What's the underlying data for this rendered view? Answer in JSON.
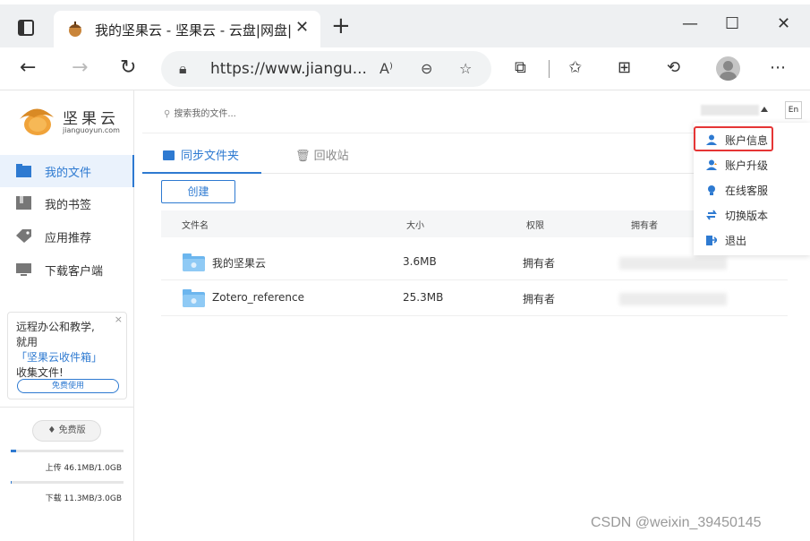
{
  "browser": {
    "tab_title": "我的坚果云 - 坚果云 - 云盘|网盘|",
    "tab_close": "✕",
    "new_tab": "+",
    "url": "https://www.jiangu...",
    "minimize": "—",
    "maximize": "☐",
    "close": "✕",
    "icons": [
      "sidebar-icon",
      "back-icon",
      "forward-icon",
      "refresh-icon",
      "lock-icon",
      "read-aloud-icon",
      "zoom-icon",
      "favorite-add-icon",
      "extensions-icon",
      "favorites-icon",
      "collections-icon",
      "history-icon",
      "profile-icon",
      "more-icon"
    ]
  },
  "app": {
    "logo_text": "坚果云",
    "logo_sub": "jianguoyun.com",
    "sidebar": {
      "items": [
        {
          "label": "我的文件",
          "icon": "folder-icon",
          "active": true
        },
        {
          "label": "我的书签",
          "icon": "bookmark-icon",
          "active": false
        },
        {
          "label": "应用推荐",
          "icon": "tag-icon",
          "active": false
        },
        {
          "label": "下载客户端",
          "icon": "monitor-icon",
          "active": false
        }
      ]
    },
    "promo": {
      "line1": "远程办公和教学,",
      "line2_prefix": "就用",
      "line2_link": "「坚果云收件箱」",
      "line3": "收集文件!",
      "button": "免费使用",
      "close": "×"
    },
    "plan": "免费版",
    "upload": {
      "text": "上传 46.1MB/1.0GB",
      "fraction": 0.045
    },
    "download": {
      "text": "下载 11.3MB/3.0GB",
      "fraction": 0.004
    },
    "search_placeholder": "搜索我的文件...",
    "lang": "En",
    "tabs": [
      {
        "label": "同步文件夹",
        "active": true
      },
      {
        "label": "回收站",
        "active": false
      }
    ],
    "create_button": "创建",
    "table": {
      "headers": [
        "文件名",
        "大小",
        "权限",
        "拥有者"
      ],
      "rows": [
        {
          "name": "我的坚果云",
          "size": "3.6MB",
          "permission": "拥有者"
        },
        {
          "name": "Zotero_reference",
          "size": "25.3MB",
          "permission": "拥有者"
        }
      ]
    },
    "dropdown": {
      "items": [
        {
          "label": "账户信息",
          "icon": "user-icon",
          "highlighted": true
        },
        {
          "label": "账户升级",
          "icon": "user-upgrade-icon",
          "highlighted": false
        },
        {
          "label": "在线客服",
          "icon": "support-icon",
          "highlighted": false
        },
        {
          "label": "切换版本",
          "icon": "switch-icon",
          "highlighted": false
        },
        {
          "label": "退出",
          "icon": "logout-icon",
          "highlighted": false
        }
      ]
    }
  },
  "watermark": "CSDN @weixin_39450145",
  "colors": {
    "accent": "#2e7ad1",
    "highlight_border": "#e53535"
  }
}
